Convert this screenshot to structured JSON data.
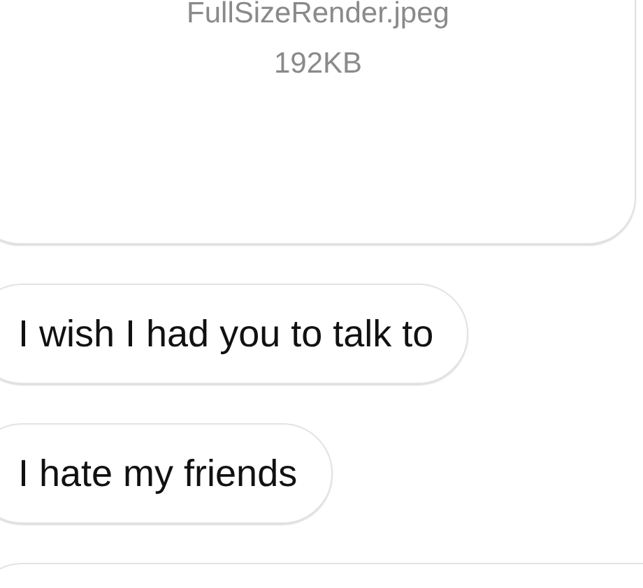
{
  "attachment": {
    "filename": "FullSizeRender.jpeg",
    "size": "192KB"
  },
  "messages": [
    {
      "text": "I wish I had you to talk to"
    },
    {
      "text": "I hate my friends"
    }
  ]
}
